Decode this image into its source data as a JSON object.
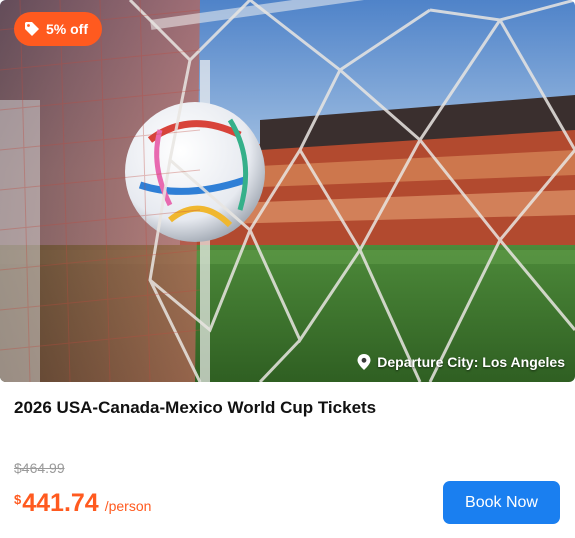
{
  "hero": {
    "discount_badge": "5% off",
    "departure_label": "Departure City: Los Angeles"
  },
  "product": {
    "title": "2026 USA-Canada-Mexico World Cup Tickets",
    "original_price": "$464.99",
    "currency_symbol": "$",
    "price": "441.74",
    "price_unit": "/person"
  },
  "actions": {
    "book_label": "Book Now"
  },
  "colors": {
    "accent": "#ff5a1f",
    "button": "#1a7ff0"
  },
  "icons": {
    "badge": "tag-icon",
    "departure": "location-pin-icon"
  }
}
